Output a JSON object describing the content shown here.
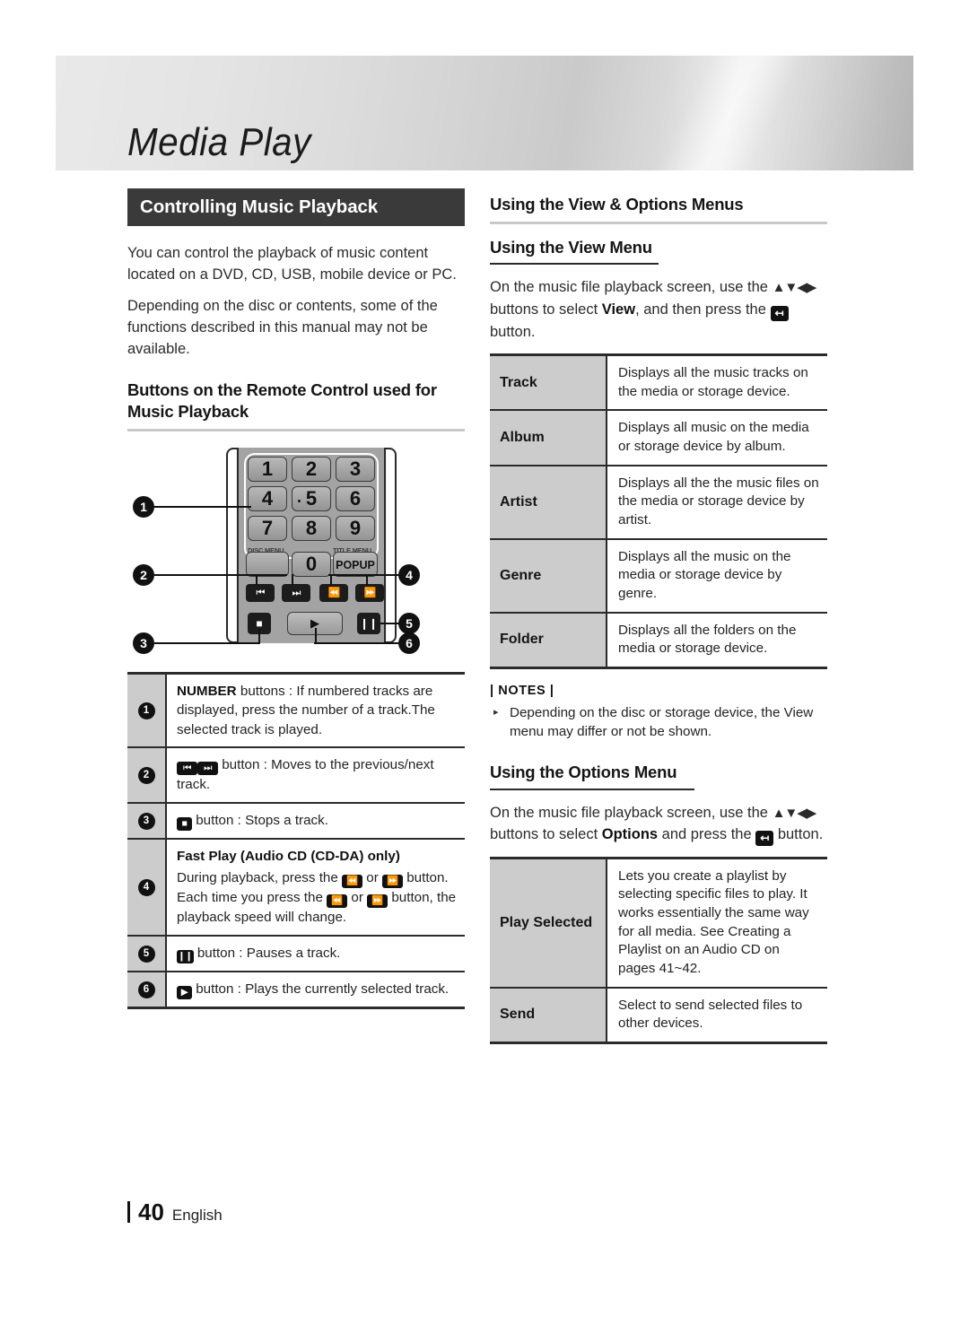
{
  "banner": {
    "title": "Media Play"
  },
  "left": {
    "section_heading": "Controlling Music Playback",
    "intro_p1": "You can control the playback of music content located on a DVD, CD, USB, mobile device or PC.",
    "intro_p2": "Depending on the disc or contents, some of the functions described in this manual may not be available.",
    "subheading": "Buttons on the Remote Control used for Music Playback",
    "remote": {
      "keys": [
        "1",
        "2",
        "3",
        "4",
        "5",
        "6",
        "7",
        "8",
        "9",
        "0"
      ],
      "popup_label": "POPUP",
      "disc_menu_label": "DISC MENU",
      "title_menu_label": "TITLE MENU",
      "transport": [
        "prev-icon",
        "next-icon",
        "rewind-icon",
        "fastforward-icon"
      ],
      "bottom_row": [
        "stop-icon",
        "play-icon",
        "pause-icon"
      ],
      "callouts": [
        "1",
        "2",
        "3",
        "4",
        "5",
        "6"
      ]
    },
    "table_rows": [
      {
        "num": "1",
        "lines": [
          {
            "bold": "NUMBER",
            "rest": " buttons : If numbered tracks are displayed, press the number of a track.The selected track is played."
          }
        ]
      },
      {
        "num": "2",
        "icons": [
          "prev-icon",
          "next-icon"
        ],
        "text": " button : Moves to the previous/next track."
      },
      {
        "num": "3",
        "icons": [
          "stop-icon"
        ],
        "text": " button : Stops a track."
      },
      {
        "num": "4",
        "title": "Fast Play (Audio CD (CD-DA) only)",
        "line1_a": "During playback, press the ",
        "line1_b": " or ",
        "line1_c": " button.",
        "line2_a": "Each time you press the ",
        "line2_b": " or ",
        "line2_c": " button, the playback speed will change."
      },
      {
        "num": "5",
        "icons": [
          "pause-icon"
        ],
        "text": " button : Pauses a track."
      },
      {
        "num": "6",
        "icons": [
          "play-icon"
        ],
        "text": " button : Plays the currently selected track."
      }
    ]
  },
  "right": {
    "heading": "Using the View & Options Menus",
    "view_menu": {
      "subheading": "Using the View Menu",
      "intro_a": "On the music file playback screen, use the ",
      "intro_arrows": "▲▼◀▶",
      "intro_b": " buttons to select ",
      "intro_bold": "View",
      "intro_c": ", and then press the ",
      "intro_d": " button.",
      "rows": [
        {
          "label": "Track",
          "desc": "Displays all the music tracks on the media or storage device."
        },
        {
          "label": "Album",
          "desc": "Displays all music on the media or storage device by album."
        },
        {
          "label": "Artist",
          "desc": "Displays all the the music files on the media or storage device by artist."
        },
        {
          "label": "Genre",
          "desc": "Displays all the music on the media or storage device by genre."
        },
        {
          "label": "Folder",
          "desc": "Displays all the folders on the media or storage device."
        }
      ]
    },
    "notes": {
      "title": "| NOTES |",
      "items": [
        "Depending on the disc or storage device, the View menu may differ or not be shown."
      ]
    },
    "options_menu": {
      "subheading": "Using the Options Menu",
      "intro_a": "On the music file playback screen, use the ",
      "intro_arrows": "▲▼◀▶",
      "intro_b": " buttons to select ",
      "intro_bold": "Options",
      "intro_c": " and press the ",
      "intro_d": " button.",
      "rows": [
        {
          "label": "Play Selected",
          "desc": "Lets you create a playlist by selecting specific files to play. It works essentially the same way for all media. See Creating a Playlist on an Audio CD on pages 41~42."
        },
        {
          "label": "Send",
          "desc": "Select to send selected files to other devices."
        }
      ]
    }
  },
  "footer": {
    "page": "40",
    "language": "English"
  },
  "colors": {
    "heading_bar": "#3a3a3a",
    "table_label_bg": "#cccccc",
    "rule": "#2b2b2b"
  }
}
